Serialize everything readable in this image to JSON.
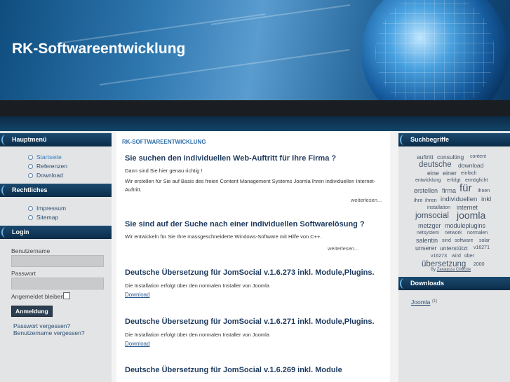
{
  "header": {
    "site_title": "RK-Softwareentwicklung"
  },
  "left": {
    "main_menu": {
      "title": "Hauptmenü",
      "items": [
        "Startseite",
        "Referenzen",
        "Download"
      ]
    },
    "legal": {
      "title": "Rechtliches",
      "items": [
        "Impressum",
        "Sitemap"
      ]
    },
    "login": {
      "title": "Login",
      "username_label": "Benutzername",
      "password_label": "Passwort",
      "remember_label": "Angemeldet bleiben",
      "submit_label": "Anmeldung",
      "forgot_password": "Passwort vergessen?",
      "forgot_username": "Benutzername vergessen?"
    }
  },
  "main": {
    "breadcrumb": "RK-SOFTWAREENTWICKLUNG",
    "articles": [
      {
        "title": "Sie suchen den individuellen Web-Auftritt für Ihre Firma ?",
        "text1": "Dann sind Sie hier genau richtig !",
        "text2": "Wir erstellen für Sie auf Basis des freien Content Management Systems Joomla Ihren individuellen Internet-Auftritt.",
        "more": "weiterlesen..."
      },
      {
        "title": "Sie sind auf der Suche nach einer individuellen Softwarelösung ?",
        "text1": "Wir entwickeln für Sie Ihre massgeschneiderte Windows-Software mit Hilfe von C++.",
        "more": "weiterlesen..."
      },
      {
        "title": "Deutsche Übersetzung für JomSocial v.1.6.273 inkl. Module,Plugins.",
        "text1": "Die Installation erfolgt über den normalen Installer von Joomla",
        "link": "Download"
      },
      {
        "title": "Deutsche Übersetzung für JomSocial v.1.6.271 inkl. Module,Plugins.",
        "text1": "Die Installation erfolgt über den normalen Installer von Joomla",
        "link": "Download"
      },
      {
        "title": "Deutsche Übersetzung für JomSocial v.1.6.269 inkl. Module"
      }
    ]
  },
  "right": {
    "tags_title": "Suchbegriffe",
    "tags": [
      [
        "auftritt",
        "consulting",
        "content"
      ],
      [
        "deutsche",
        "download"
      ],
      [
        "eine",
        "einer",
        "einfach"
      ],
      [
        "entwicklung",
        "erfolgt",
        "ermöglicht"
      ],
      [
        "erstellen",
        "firma",
        "für",
        "ihnen"
      ],
      [
        "ihre",
        "ihren",
        "individuellen",
        "inkl"
      ],
      [
        "installation",
        "internet"
      ],
      [
        "jomsocial",
        "joomla"
      ],
      [
        "metzger",
        "moduleplugins"
      ],
      [
        "netsystem",
        "network",
        "normalen"
      ],
      [
        "salentin",
        "sind",
        "software",
        "solar"
      ],
      [
        "unserer",
        "unterstützt",
        "v16271"
      ],
      [
        "v16273",
        "wird",
        "über"
      ],
      [
        "übersetzung",
        "2000"
      ]
    ],
    "tags_credit_by": "By",
    "tags_credit_name": "Zaragoza Clinicde",
    "downloads_title": "Downloads",
    "download_item": "Joomla",
    "download_count": "(1)"
  }
}
